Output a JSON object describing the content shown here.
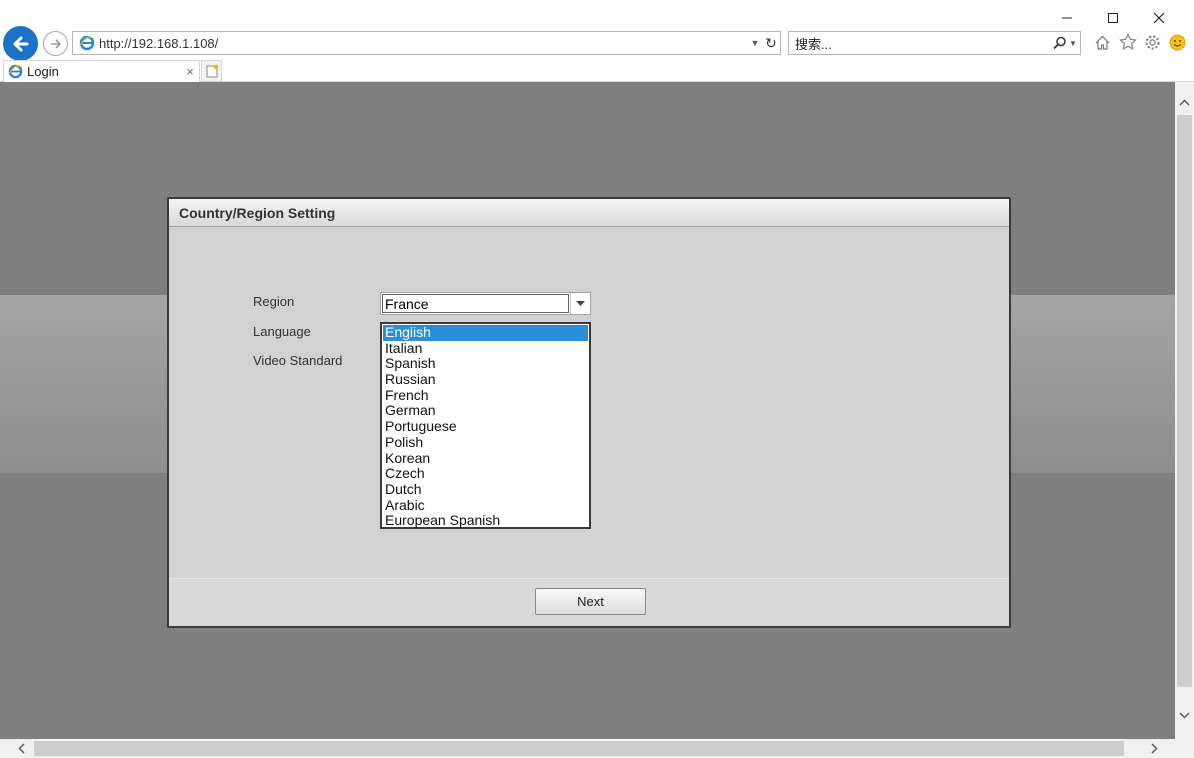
{
  "browser": {
    "address": "http://192.168.1.108/",
    "search_placeholder": "搜索...",
    "tab_title": "Login",
    "tab_close": "×"
  },
  "dialog": {
    "title": "Country/Region Setting",
    "labels": {
      "region": "Region",
      "language": "Language",
      "video_standard": "Video Standard"
    },
    "region_value": "France",
    "language_options": [
      "English",
      "Italian",
      "Spanish",
      "Russian",
      "French",
      "German",
      "Portuguese",
      "Polish",
      "Korean",
      "Czech",
      "Dutch",
      "Arabic",
      "European Spanish"
    ],
    "selected_language": "English",
    "next_label": "Next"
  },
  "colors": {
    "selection": "#2a8fd9",
    "back_button": "#1a73c8",
    "page_background": "#7f7f7f"
  }
}
